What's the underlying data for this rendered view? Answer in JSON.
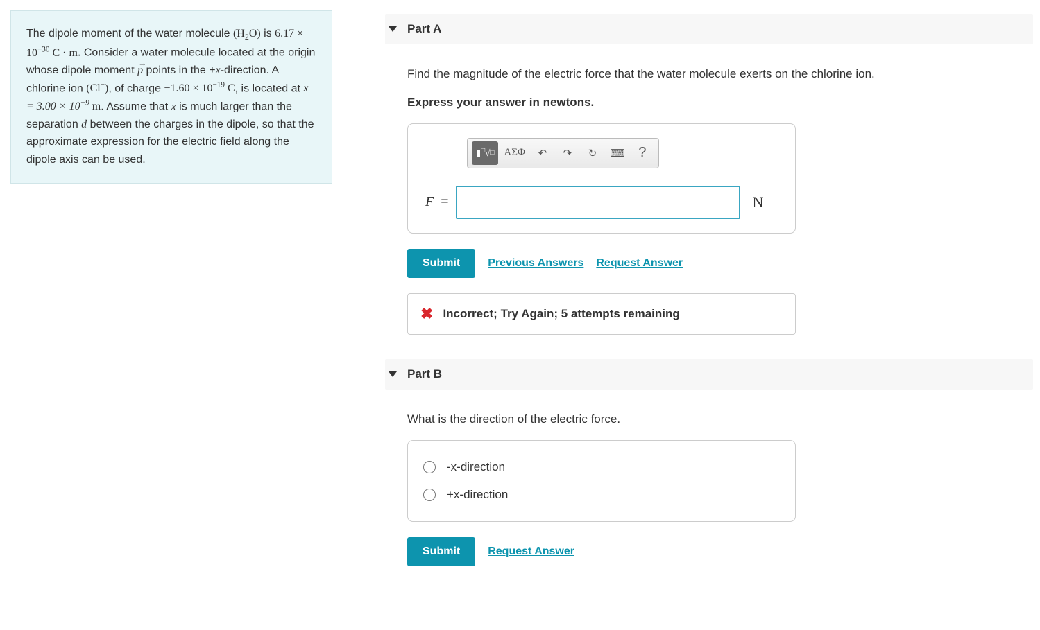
{
  "prompt": {
    "intro1": "The dipole moment of the water molecule ",
    "h2o": "(H",
    "h2o_sub": "2",
    "h2o_end": "O)",
    "intro2": " is ",
    "dipole_val": "6.17 × 10",
    "dipole_exp": "−30",
    "dipole_unit": " C · m",
    "sent2a": ". Consider a water molecule located at the origin whose dipole moment ",
    "pvec": "p",
    "sent2b": " points in the +",
    "xvar": "x",
    "sent2c": "-direction. A chlorine ion ",
    "cl": "(Cl",
    "cl_sup": "−",
    "cl_end": ")",
    "sent3a": ", of charge ",
    "charge_val": "−1.60 × 10",
    "charge_exp": "−19",
    "charge_unit": " C",
    "sent3b": ", is located at ",
    "x_eq": "x = 3.00 × 10",
    "x_exp": "−9",
    "x_unit": " m",
    "sent4a": ". Assume that ",
    "sent4b": " is much larger than the separation ",
    "dvar": "d",
    "sent4c": " between the charges in the dipole, so that the approximate expression for the electric field along the dipole axis can be used."
  },
  "partA": {
    "title": "Part A",
    "question": "Find the magnitude of the electric force that the water molecule exerts on the chlorine ion.",
    "instruction": "Express your answer in newtons.",
    "toolbar": {
      "template": "▯√▯",
      "greek": "ΑΣΦ",
      "undo": "↶",
      "redo": "↷",
      "reset": "↻",
      "keyboard": "⌨",
      "help": "?"
    },
    "var": "F",
    "eq": " = ",
    "unit": "N",
    "submit": "Submit",
    "prev_answers": "Previous Answers",
    "request_answer": "Request Answer",
    "feedback": "Incorrect; Try Again; 5 attempts remaining"
  },
  "partB": {
    "title": "Part B",
    "question": "What is the direction of the electric force.",
    "option1": "-x-direction",
    "option2": "+x-direction",
    "submit": "Submit",
    "request_answer": "Request Answer"
  }
}
